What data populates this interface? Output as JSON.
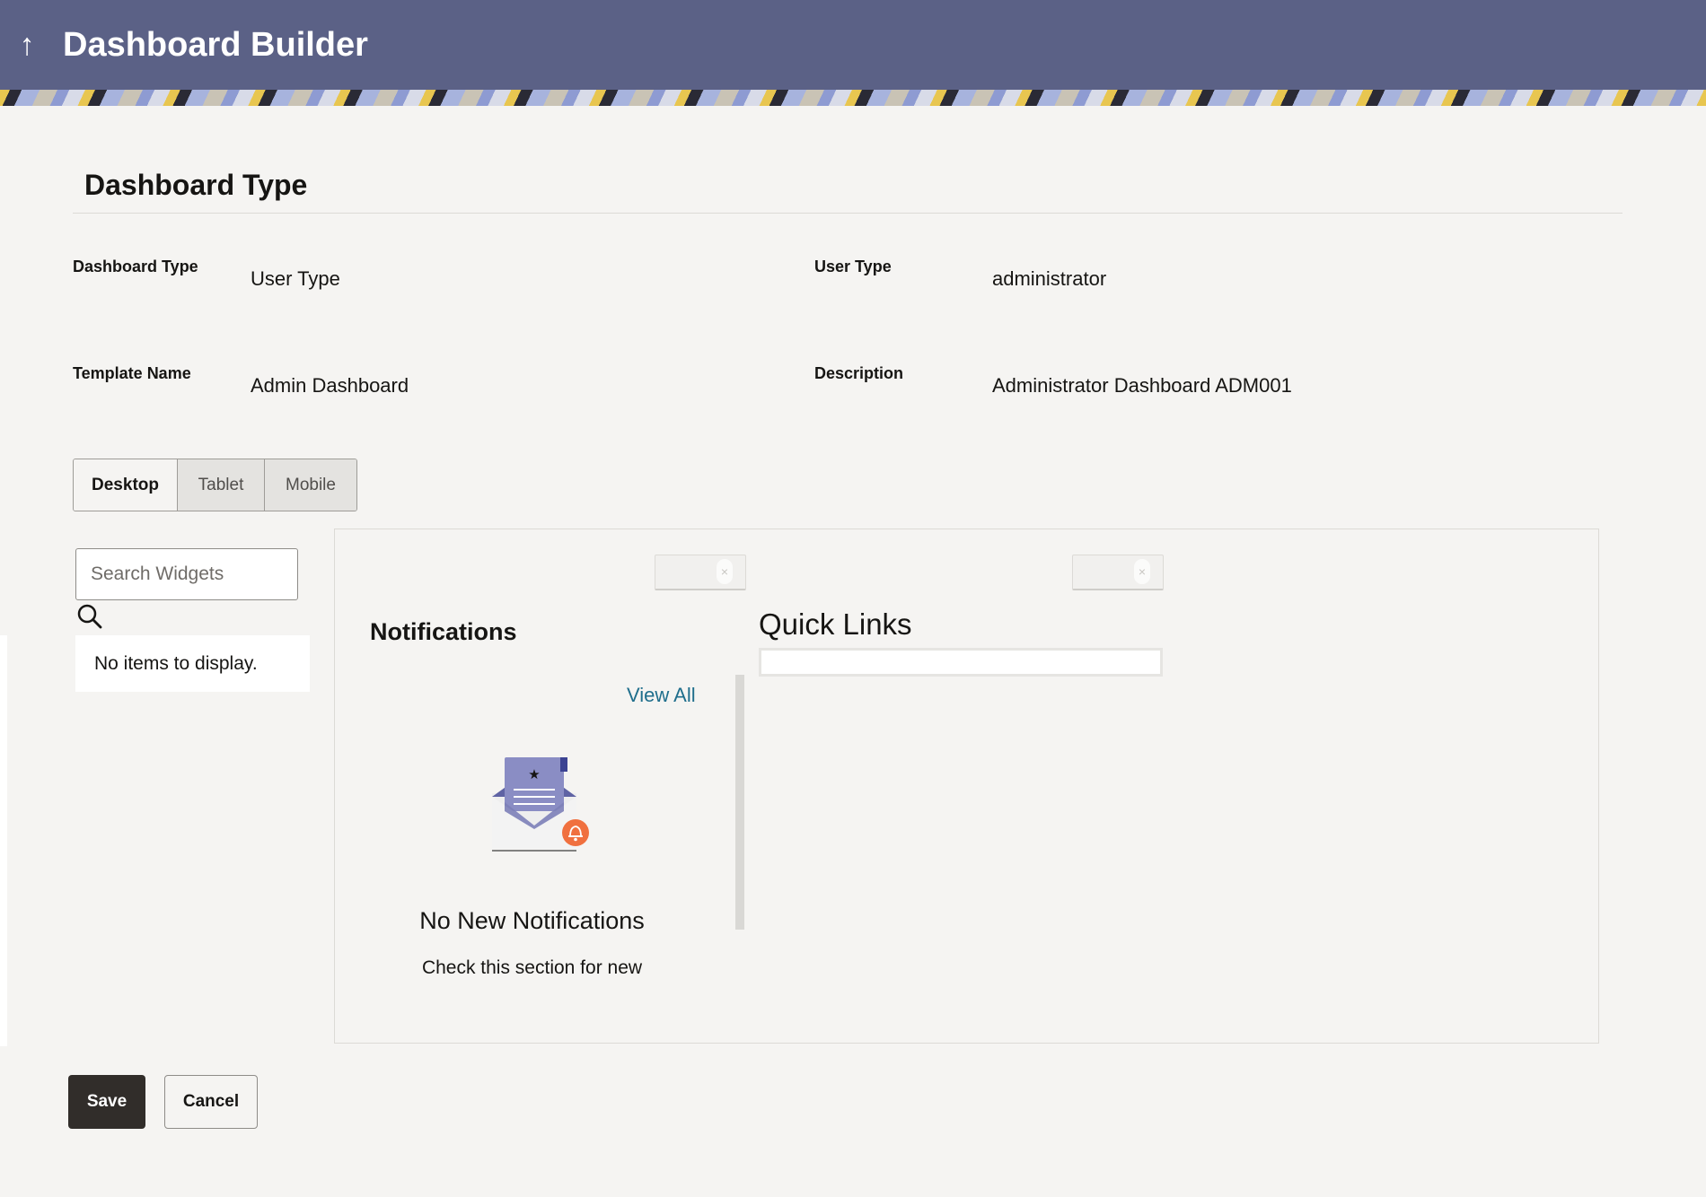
{
  "header": {
    "back_icon": "arrow-up-icon",
    "back_glyph": "↑",
    "title": "Dashboard Builder",
    "background_color": "#5b6186"
  },
  "section": {
    "title": "Dashboard Type"
  },
  "fields": {
    "dashboard_type": {
      "label": "Dashboard Type",
      "value": "User Type"
    },
    "user_type": {
      "label": "User Type",
      "value": "administrator"
    },
    "template_name": {
      "label": "Template Name",
      "value": "Admin Dashboard"
    },
    "description": {
      "label": "Description",
      "value": "Administrator Dashboard ADM001"
    }
  },
  "device_tabs": [
    {
      "label": "Desktop",
      "active": true
    },
    {
      "label": "Tablet",
      "active": false
    },
    {
      "label": "Mobile",
      "active": false
    }
  ],
  "widget_panel": {
    "search_placeholder": "Search Widgets",
    "search_value": "",
    "search_icon": "search-icon",
    "empty_text": "No items to display."
  },
  "canvas": {
    "notifications_widget": {
      "title": "Notifications",
      "view_all_label": "View All",
      "illustration_icon": "envelope-bell-icon",
      "empty_heading": "No New Notifications",
      "empty_subtext": "Check this section for new",
      "remove_glyph": "×"
    },
    "quick_links_widget": {
      "title": "Quick Links",
      "remove_glyph": "×"
    }
  },
  "footer": {
    "save_label": "Save",
    "cancel_label": "Cancel",
    "save_color": "#312d2a"
  },
  "colors": {
    "link": "#1f6e8c",
    "notification_badge": "#f0703f",
    "envelope": "#7c7fb8"
  }
}
